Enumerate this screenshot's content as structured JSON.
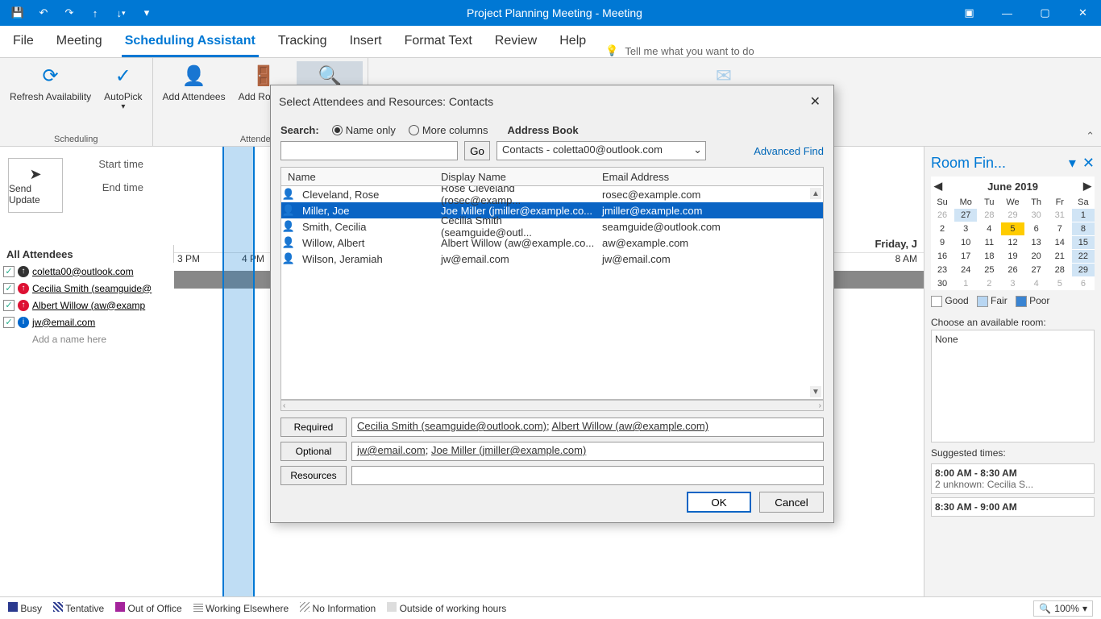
{
  "titlebar": {
    "title": "Project Planning Meeting  -  Meeting"
  },
  "tabs": [
    "File",
    "Meeting",
    "Scheduling Assistant",
    "Tracking",
    "Insert",
    "Format Text",
    "Review",
    "Help"
  ],
  "active_tab": 2,
  "tellme_placeholder": "Tell me what you want to do",
  "ribbon": {
    "groups": [
      {
        "label": "Scheduling",
        "items": [
          {
            "label": "Refresh Availability"
          },
          {
            "label": "AutoPick"
          }
        ]
      },
      {
        "label": "Attendees",
        "items": [
          {
            "label": "Add Attendees"
          },
          {
            "label": "Add Rooms"
          },
          {
            "label": "Room Finder"
          }
        ]
      }
    ]
  },
  "send_button": "Send Update",
  "time_labels": {
    "start": "Start time",
    "end": "End time"
  },
  "grid": {
    "day": "Friday, J",
    "hours": [
      "3 PM",
      "4 PM"
    ],
    "right_hour": "8 AM",
    "attendees_header": "All Attendees",
    "attendees": [
      {
        "type": "org",
        "name": "coletta00@outlook.com"
      },
      {
        "type": "req",
        "name": "Cecilia Smith (seamguide@"
      },
      {
        "type": "req",
        "name": "Albert Willow (aw@examp"
      },
      {
        "type": "opt",
        "name": "jw@email.com"
      }
    ],
    "add_name": "Add a name here"
  },
  "room_finder": {
    "title": "Room Fin...",
    "month": "June 2019",
    "dow": [
      "Su",
      "Mo",
      "Tu",
      "We",
      "Th",
      "Fr",
      "Sa"
    ],
    "days": [
      {
        "n": "26",
        "dim": true
      },
      {
        "n": "27",
        "hl": true
      },
      {
        "n": "28",
        "dim": true
      },
      {
        "n": "29",
        "dim": true
      },
      {
        "n": "30",
        "dim": true
      },
      {
        "n": "31",
        "dim": true
      },
      {
        "n": "1",
        "hl": true
      },
      {
        "n": "2"
      },
      {
        "n": "3"
      },
      {
        "n": "4"
      },
      {
        "n": "5",
        "today": true
      },
      {
        "n": "6"
      },
      {
        "n": "7"
      },
      {
        "n": "8",
        "hl": true
      },
      {
        "n": "9"
      },
      {
        "n": "10"
      },
      {
        "n": "11"
      },
      {
        "n": "12"
      },
      {
        "n": "13"
      },
      {
        "n": "14"
      },
      {
        "n": "15",
        "hl": true
      },
      {
        "n": "16"
      },
      {
        "n": "17"
      },
      {
        "n": "18"
      },
      {
        "n": "19"
      },
      {
        "n": "20"
      },
      {
        "n": "21"
      },
      {
        "n": "22",
        "hl": true
      },
      {
        "n": "23"
      },
      {
        "n": "24"
      },
      {
        "n": "25"
      },
      {
        "n": "26"
      },
      {
        "n": "27"
      },
      {
        "n": "28"
      },
      {
        "n": "29",
        "hl": true
      },
      {
        "n": "30"
      },
      {
        "n": "1",
        "dim": true
      },
      {
        "n": "2",
        "dim": true
      },
      {
        "n": "3",
        "dim": true
      },
      {
        "n": "4",
        "dim": true
      },
      {
        "n": "5",
        "dim": true
      },
      {
        "n": "6",
        "dim": true
      }
    ],
    "legend": [
      "Good",
      "Fair",
      "Poor"
    ],
    "choose_label": "Choose an available room:",
    "room_list": "None",
    "sugg_label": "Suggested times:",
    "suggestions": [
      {
        "time": "8:00 AM - 8:30 AM",
        "sub": "2 unknown: Cecilia S..."
      },
      {
        "time": "8:30 AM - 9:00 AM",
        "sub": ""
      }
    ]
  },
  "statusbar": {
    "items": [
      "Busy",
      "Tentative",
      "Out of Office",
      "Working Elsewhere",
      "No Information",
      "Outside of working hours"
    ],
    "zoom": "100%"
  },
  "dialog": {
    "title": "Select Attendees and Resources: Contacts",
    "search_label": "Search:",
    "radio_name": "Name only",
    "radio_more": "More columns",
    "addrbook_label": "Address Book",
    "go": "Go",
    "address_book": "Contacts - coletta00@outlook.com",
    "advanced": "Advanced Find",
    "cols": [
      "Name",
      "Display Name",
      "Email Address"
    ],
    "contacts": [
      {
        "name": "Cleveland, Rose",
        "disp": "Rose Cleveland (rosec@examp...",
        "email": "rosec@example.com",
        "sel": false
      },
      {
        "name": "Miller, Joe",
        "disp": "Joe Miller (jmiller@example.co...",
        "email": "jmiller@example.com",
        "sel": true
      },
      {
        "name": "Smith, Cecilia",
        "disp": "Cecilia Smith (seamguide@outl...",
        "email": "seamguide@outlook.com",
        "sel": false
      },
      {
        "name": "Willow, Albert",
        "disp": "Albert Willow (aw@example.co...",
        "email": "aw@example.com",
        "sel": false
      },
      {
        "name": "Wilson, Jeramiah",
        "disp": "jw@email.com",
        "email": "jw@email.com",
        "sel": false
      }
    ],
    "required_btn": "Required",
    "optional_btn": "Optional",
    "resources_btn": "Resources",
    "required_val_a": "Cecilia Smith (seamguide@outlook.com)",
    "required_val_b": "Albert Willow (aw@example.com)",
    "optional_val_a": "jw@email.com",
    "optional_val_b": "Joe Miller (jmiller@example.com)",
    "ok": "OK",
    "cancel": "Cancel"
  }
}
